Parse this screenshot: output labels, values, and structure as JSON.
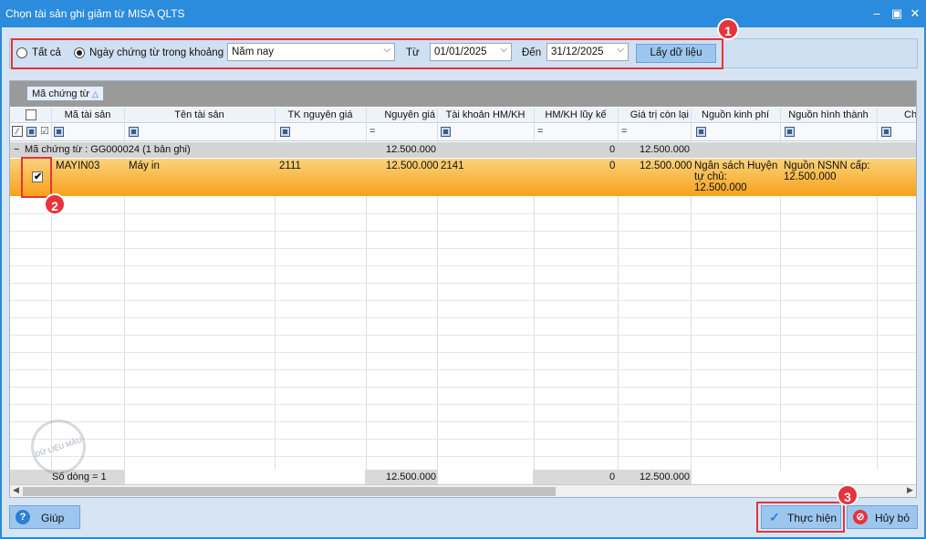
{
  "window": {
    "title": "Chọn tài sản ghi giảm từ MISA QLTS"
  },
  "filter": {
    "all_label": "Tất cả",
    "range_label": "Ngày chứng từ trong khoảng",
    "period_value": "Năm nay",
    "from_label": "Từ",
    "from_value": "01/01/2025",
    "to_label": "Đến",
    "to_value": "31/12/2025",
    "fetch_button": "Lấy dữ liệu"
  },
  "badges": [
    "1",
    "2",
    "3"
  ],
  "grid": {
    "group_chip": "Mã chứng từ",
    "columns": [
      "Mã tài sản",
      "Tên tài sản",
      "TK nguyên giá",
      "Nguyên giá",
      "Tài khoản HM/KH",
      "HM/KH lũy kế",
      "Giá trị còn lại",
      "Nguồn kinh phí",
      "Nguồn hình thành",
      "Ch"
    ],
    "group_row": {
      "label": "Mã chứng từ : GG000024 (1 bản ghi)",
      "original_cost": "12.500.000",
      "depreciation": "0",
      "remaining": "12.500.000"
    },
    "row": {
      "asset_code": "MAYIN03",
      "asset_name": "Máy in",
      "cost_account": "2111",
      "original_cost": "12.500.000",
      "dep_account": "2141",
      "depreciation": "0",
      "remaining": "12.500.000",
      "fund_source_1": "Ngân sách Huyện",
      "fund_source_2": "tự chủ:",
      "fund_source_3": "12.500.000",
      "formation_source_1": "Nguồn NSNN cấp:",
      "formation_source_2": "12.500.000"
    },
    "footer": {
      "row_count": "Số dòng = 1",
      "original_cost": "12.500.000",
      "depreciation": "0",
      "remaining": "12.500.000"
    },
    "watermark": "DỮ LIỆU MẪU"
  },
  "buttons": {
    "help": "Giúp",
    "execute": "Thực hiện",
    "cancel": "Hủy bỏ"
  },
  "colors": {
    "titlebar": "#2b8bdc",
    "accent_red": "#e5343b",
    "selected_row": "#f6a21a",
    "button": "#9dc6ef"
  }
}
